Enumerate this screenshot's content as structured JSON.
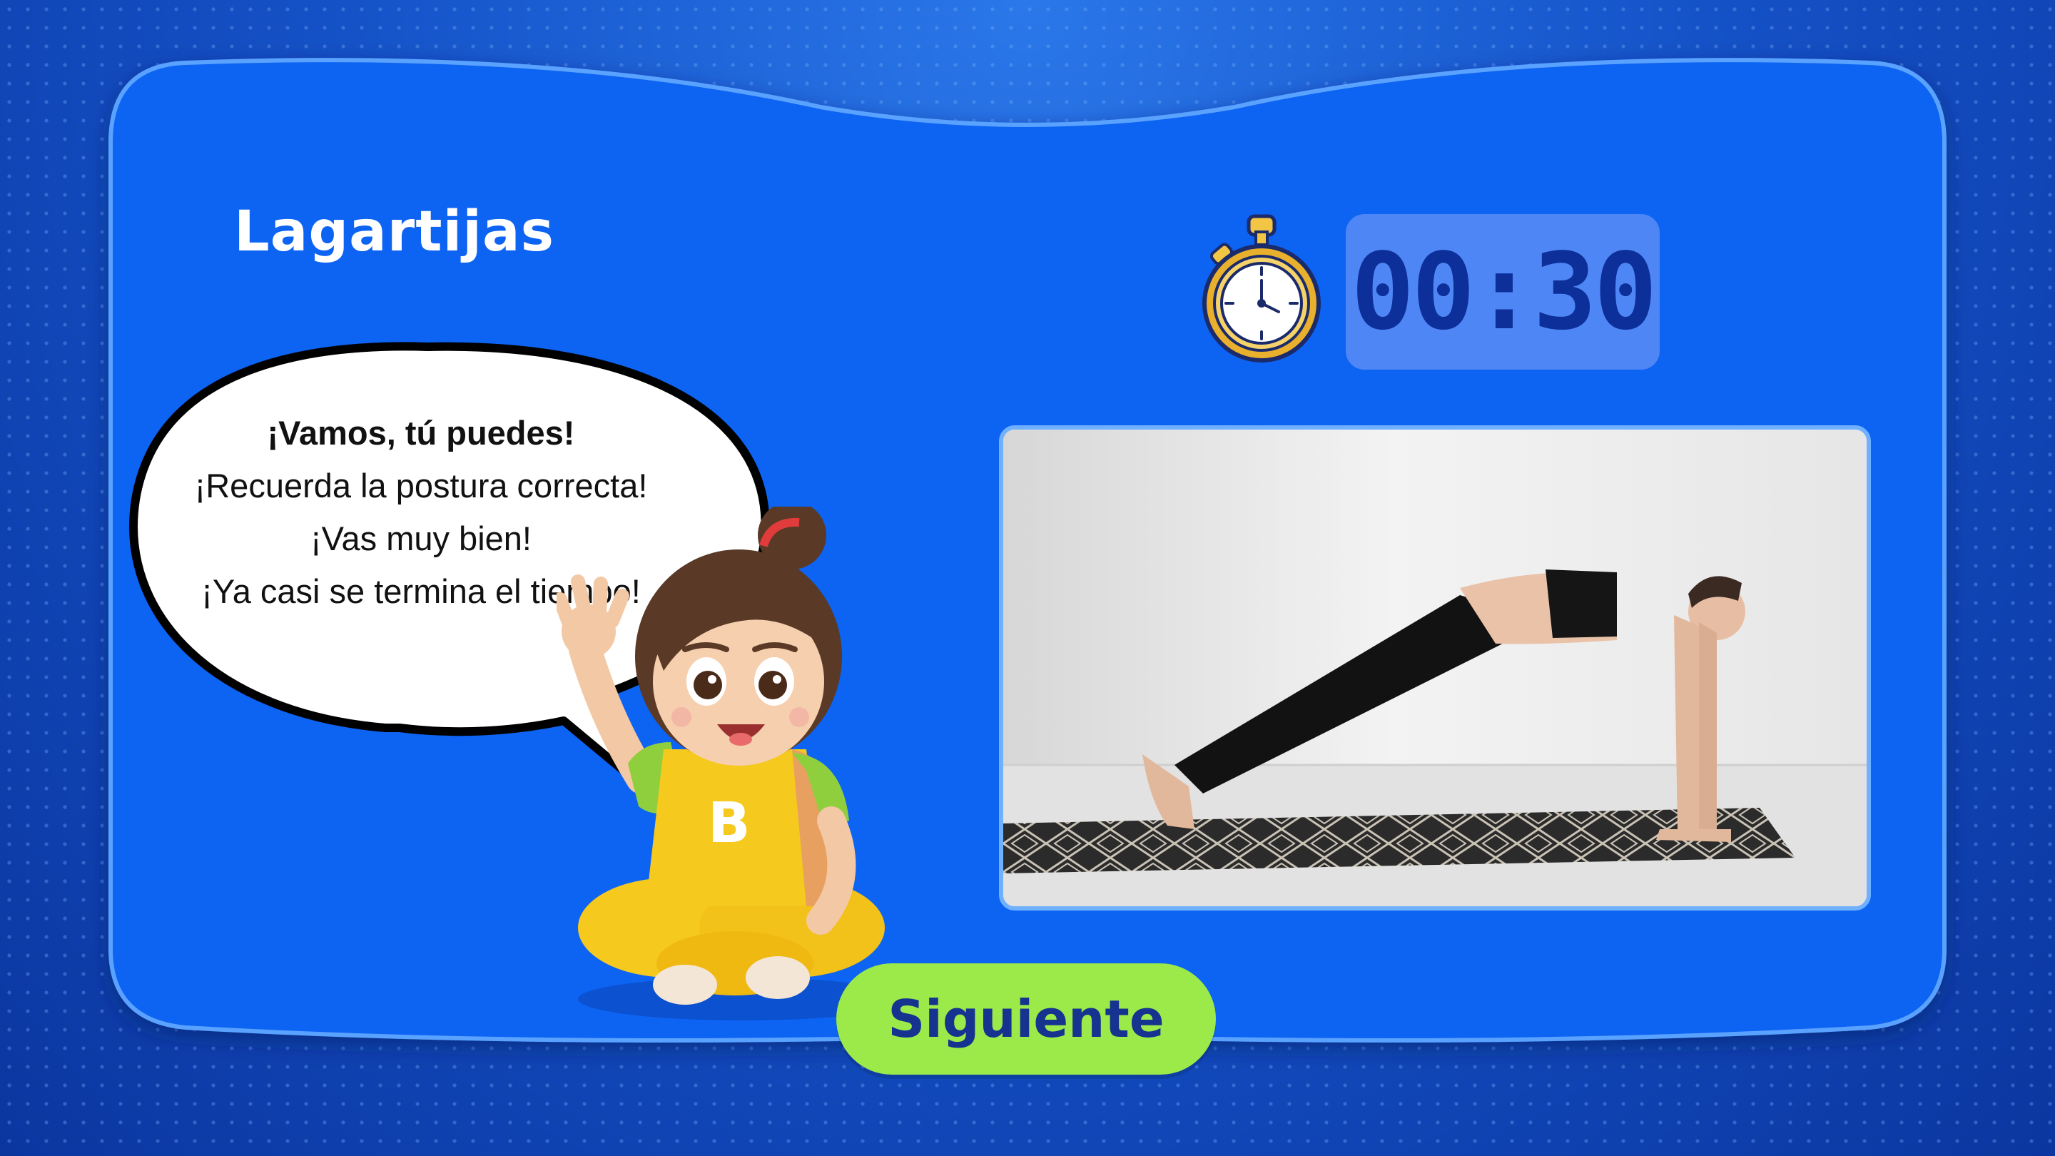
{
  "exercise": {
    "title": "Lagartijas"
  },
  "timer": {
    "value": "00:30",
    "icon": "stopwatch-icon"
  },
  "speech_bubble": {
    "line1": "¡Vamos, tú puedes!",
    "line2": "¡Recuerda la postura correcta!",
    "line3": "¡Vas muy bien!",
    "line4": "¡Ya casi se termina el tiempo!"
  },
  "mascot": {
    "shirt_letter": "B"
  },
  "actions": {
    "next_label": "Siguiente"
  },
  "colors": {
    "panel": "#0e63f2",
    "panel_border": "#5aa2ff",
    "timer_box": "#4f86f5",
    "timer_text": "#0d2f9a",
    "button": "#9bea4a",
    "button_text": "#15338f"
  }
}
